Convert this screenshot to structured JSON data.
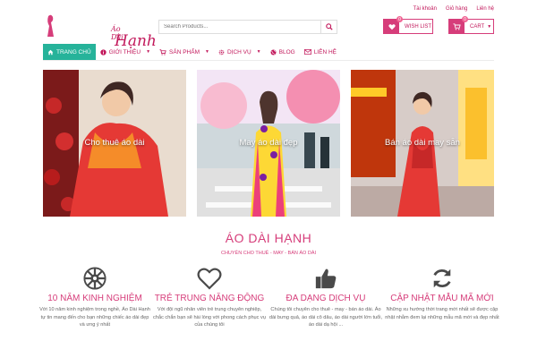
{
  "header": {
    "logo_small": "Áo Dài",
    "logo_big": "Hạnh",
    "top_links": [
      "Tài khoản",
      "Giỏ hàng",
      "Liên hệ"
    ],
    "search_placeholder": "Search Products...",
    "wishlist": {
      "label": "WISH LIST",
      "count": "0"
    },
    "cart": {
      "label": "CART",
      "count": "0"
    }
  },
  "nav": {
    "items": [
      {
        "label": "TRANG CHỦ",
        "icon": "home-icon",
        "active": true
      },
      {
        "label": "GIỚI THIỆU",
        "icon": "info-icon"
      },
      {
        "label": "SẢN PHẨM",
        "icon": "cart-icon"
      },
      {
        "label": "DỊCH VỤ",
        "icon": "cog-icon"
      },
      {
        "label": "BLOG",
        "icon": "globe-icon"
      },
      {
        "label": "LIÊN HỆ",
        "icon": "envelope-icon"
      }
    ]
  },
  "banners": [
    {
      "label": "Cho thuê áo dài"
    },
    {
      "label": "May áo dài đẹp"
    },
    {
      "label": "Bán áo dài may sẵn"
    }
  ],
  "intro": {
    "title": "ÁO DÀI HẠNH",
    "subtitle": "CHUYÊN CHO THUÊ - MAY - BÁN ÁO DÀI"
  },
  "features": [
    {
      "icon": "empire-icon",
      "title": "10 NĂM KINH NGHIỆM",
      "desc": "Với 10 năm kinh nghiệm trong nghề, Áo Dài Hạnh tự tin mang đến cho bạn những chiếc áo dài đẹp và ưng ý nhất"
    },
    {
      "icon": "heart-icon",
      "title": "TRẺ TRUNG NĂNG ĐỘNG",
      "desc": "Với đội ngũ nhân viên trẻ trung chuyên nghiệp, chắc chắn bạn sẽ hài lòng với phong cách phục vụ của chúng tôi"
    },
    {
      "icon": "thumbs-up-icon",
      "title": "ĐA DẠNG DỊCH VỤ",
      "desc": "Chúng tôi chuyên cho thuê - may - bán áo dài. Áo dài bưng quả, áo dài cô dâu, áo dài người lớn tuổi, áo dài dạ hội ..."
    },
    {
      "icon": "refresh-icon",
      "title": "CẬP NHẬT MẪU MÃ MỚI",
      "desc": "Những xu hướng thời trang mới nhất sẽ được cập nhật nhằm đem lại những mẫu mã mới và đẹp nhất"
    }
  ],
  "colors": {
    "brand": "#d63d7a",
    "nav_active": "#26b39a"
  }
}
